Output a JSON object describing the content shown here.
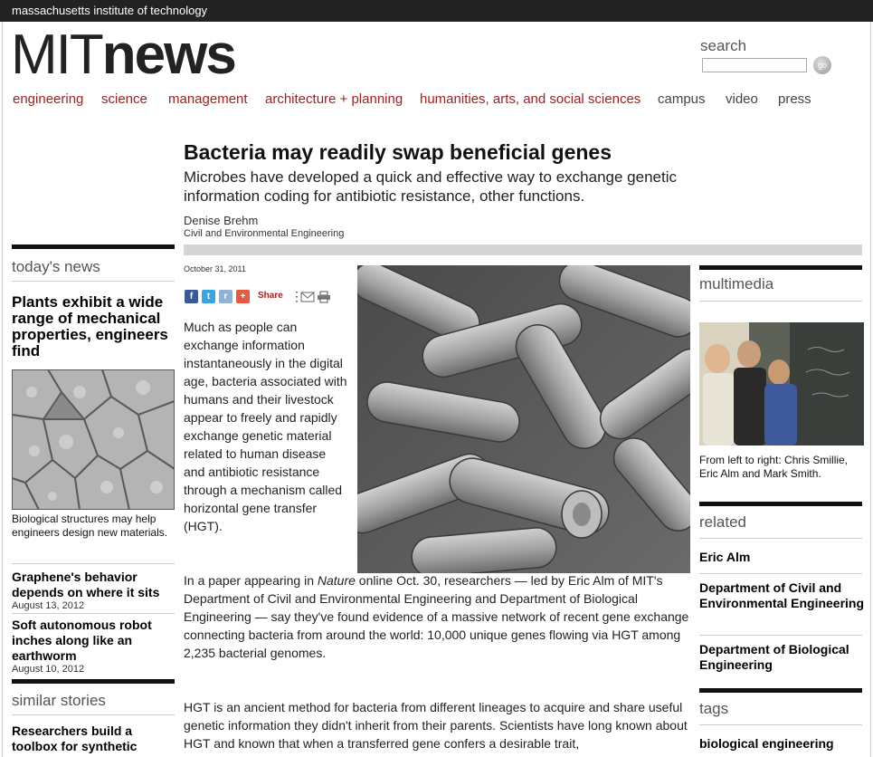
{
  "topbar": {
    "institute": "massachusetts institute of technology"
  },
  "logo": {
    "mit": "MIT",
    "news": "news"
  },
  "search": {
    "label": "search",
    "input_value": "",
    "go_label": "go"
  },
  "nav": {
    "items": [
      {
        "label": "engineering",
        "style": "red"
      },
      {
        "label": "science",
        "style": "red"
      },
      {
        "label": "management",
        "style": "red"
      },
      {
        "label": "architecture + planning",
        "style": "red"
      },
      {
        "label": "humanities, arts, and social sciences",
        "style": "red"
      },
      {
        "label": "campus",
        "style": "gray"
      },
      {
        "label": "video",
        "style": "gray"
      },
      {
        "label": "press",
        "style": "gray"
      }
    ]
  },
  "article": {
    "headline": "Bacteria may readily swap beneficial genes",
    "dek": "Microbes have developed a quick and effective way to exchange genetic information coding for antibiotic resistance, other functions.",
    "author": "Denise Brehm",
    "department": "Civil and Environmental Engineering",
    "date": "October 31, 2011",
    "share_label": "Share",
    "share_icons": [
      "facebook-icon",
      "twitter-icon",
      "reddit-icon",
      "addthis-icon"
    ],
    "para1": "Much as people can exchange information instantaneously in the digital age, bacteria associated with humans and their livestock appear to freely and rapidly exchange genetic material related to human disease and antibiotic resistance through a mechanism called horizontal gene transfer (HGT).",
    "para2_pre": "In a paper appearing in ",
    "para2_italic": "Nature",
    "para2_post": " online Oct. 30, researchers — led by Eric Alm of MIT's Department of Civil and Environmental Engineering and Department of Biological Engineering — say they've found evidence of a massive network of recent gene exchange connecting bacteria from around the world: 10,000 unique genes flowing via HGT among 2,235 bacterial genomes.",
    "para3": "HGT is an ancient method for bacteria from different lineages to acquire and share useful genetic information they didn't inherit from their parents. Scientists have long known about HGT and known that when a transferred gene confers a desirable trait,"
  },
  "left": {
    "todays_news_heading": "today's news",
    "lead_story_title": "Plants exhibit a wide range of mechanical properties, engineers find",
    "lead_story_caption": "Biological structures may help engineers design new materials.",
    "stories": [
      {
        "title": "Graphene's behavior depends on where it sits",
        "date": "August 13, 2012"
      },
      {
        "title": "Soft autonomous robot inches along like an earthworm",
        "date": "August 10, 2012"
      }
    ],
    "similar_heading": "similar stories",
    "similar_first": "Researchers build a toolbox for synthetic"
  },
  "right": {
    "multimedia_heading": "multimedia",
    "multimedia_caption": "From left to right: Chris Smillie, Eric Alm and Mark Smith.",
    "related_heading": "related",
    "related": [
      "Eric Alm",
      "Department of Civil and Environmental Engineering",
      "Department of Biological Engineering"
    ],
    "tags_heading": "tags",
    "tags": [
      "biological engineering"
    ]
  },
  "colors": {
    "accent_red": "#a31f1f",
    "topbar": "#222222"
  }
}
